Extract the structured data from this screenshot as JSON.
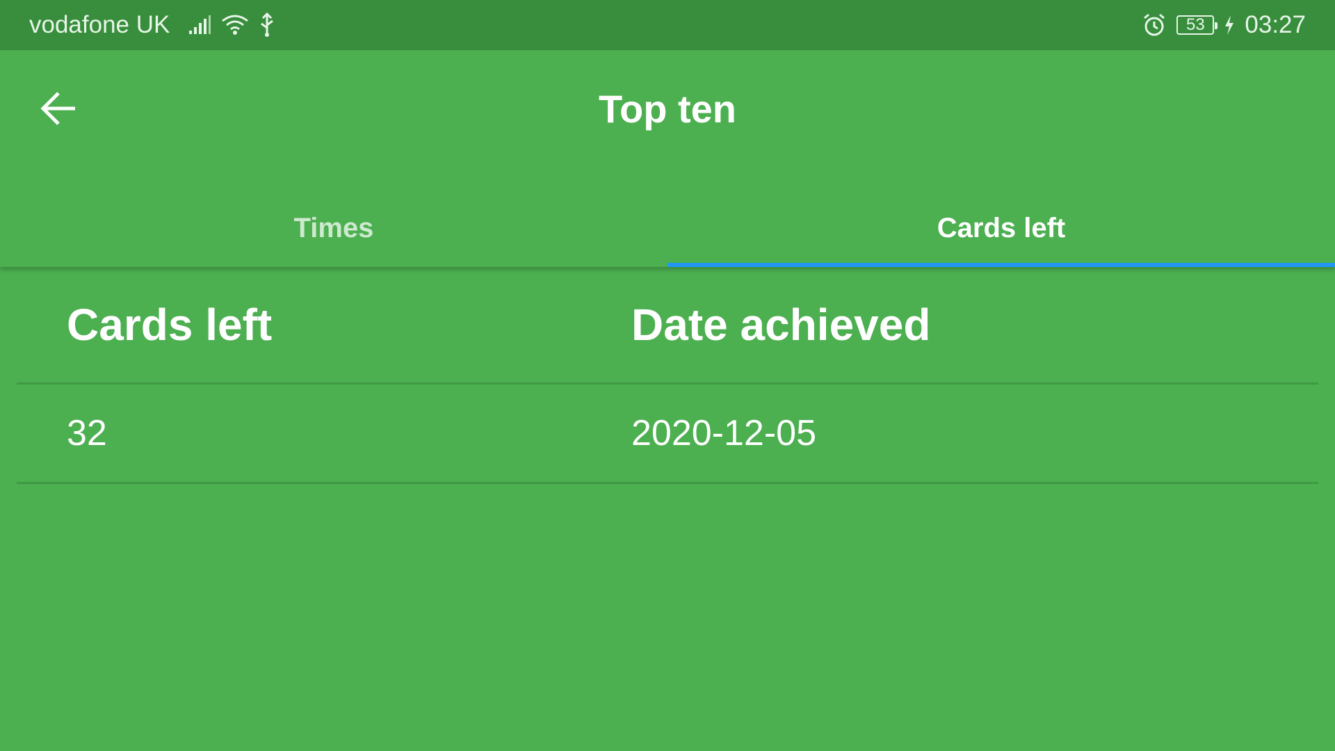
{
  "status_bar": {
    "carrier": "vodafone UK",
    "battery": "53",
    "time": "03:27",
    "icons": [
      "signal-icon",
      "wifi-icon",
      "usb-icon",
      "alarm-icon",
      "battery-icon",
      "charging-icon"
    ]
  },
  "app_bar": {
    "title": "Top ten",
    "back_icon": "arrow-back-icon"
  },
  "tabs": [
    {
      "label": "Times",
      "active": false
    },
    {
      "label": "Cards left",
      "active": true
    }
  ],
  "table": {
    "columns": [
      "Cards left",
      "Date achieved"
    ],
    "rows": [
      [
        "32",
        "2020-12-05"
      ]
    ]
  },
  "colors": {
    "primary": "#4caf50",
    "status_bar": "#388e3c",
    "tab_indicator": "#2196f3",
    "divider": "#3f9a43",
    "text": "#ffffff"
  }
}
